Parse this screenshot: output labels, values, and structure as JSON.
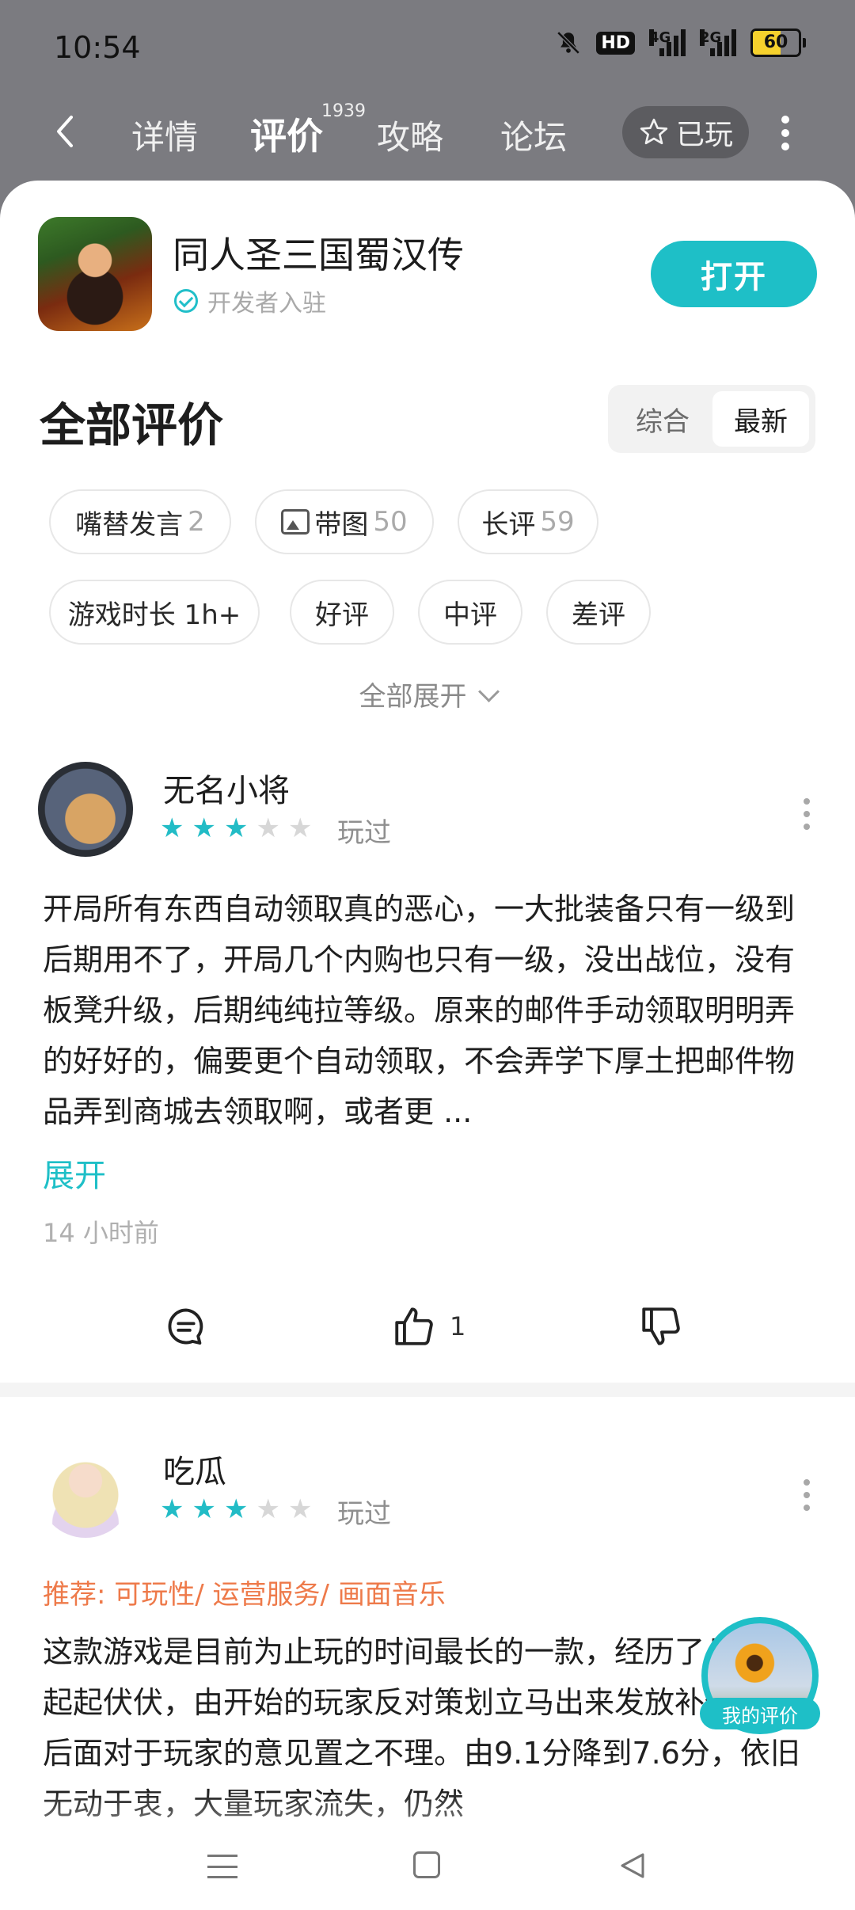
{
  "status_bar": {
    "time": "10:54",
    "hd_label": "HD",
    "network_1": "4G",
    "network_2": "2G",
    "battery": "60",
    "battery_level": 0.6,
    "icons": [
      "bell-mute-icon",
      "hd-icon",
      "signal-4g-icon",
      "signal-2g-icon",
      "battery-icon"
    ]
  },
  "nav": {
    "tabs": [
      {
        "label": "详情"
      },
      {
        "label": "评价",
        "count": "1939"
      },
      {
        "label": "攻略"
      },
      {
        "label": "论坛"
      }
    ],
    "played_label": "已玩"
  },
  "game": {
    "name": "同人圣三国蜀汉传",
    "developer_badge": "开发者入驻",
    "open_label": "打开"
  },
  "reviews_section": {
    "title": "全部评价",
    "sort_options": [
      "综合",
      "最新"
    ],
    "sort_selected": "最新",
    "filters": [
      {
        "label": "嘴替发言",
        "count": "2"
      },
      {
        "label": "带图",
        "count": "50"
      },
      {
        "label": "长评",
        "count": "59"
      },
      {
        "label": "游戏时长 1h+"
      },
      {
        "label": "好评"
      },
      {
        "label": "中评"
      },
      {
        "label": "差评"
      }
    ],
    "expand_all": "全部展开"
  },
  "reviews": [
    {
      "user": "无名小将",
      "rating": 3,
      "max_rating": 5,
      "played": "玩过",
      "text": "开局所有东西自动领取真的恶心，一大批装备只有一级到后期用不了，开局几个内购也只有一级，没出战位，没有板凳升级，后期纯纯拉等级。原来的邮件手动领取明明弄的好好的，偏要更个自动领取，不会弄学下厚土把邮件物品弄到商城去领取啊，或者更 ...",
      "expand": "展开",
      "time": "14 小时前",
      "likes": "1"
    },
    {
      "user": "吃瓜",
      "rating": 3,
      "max_rating": 5,
      "played": "玩过",
      "recommend": "推荐: 可玩性/ 运营服务/ 画面音乐",
      "text": "这款游戏是目前为止玩的时间最长的一款，经历了几次的起起伏伏，由开始的玩家反对策划立马出来发放补偿，到后面对于玩家的意见置之不理。由9.1分降到7.6分，依旧无动于衷，大量玩家流失，仍然"
    }
  ],
  "my_review_label": "我的评价",
  "colors": {
    "accent": "#1ebfc7",
    "recommend": "#ee7a4a",
    "header_bg": "#7b7b80"
  }
}
